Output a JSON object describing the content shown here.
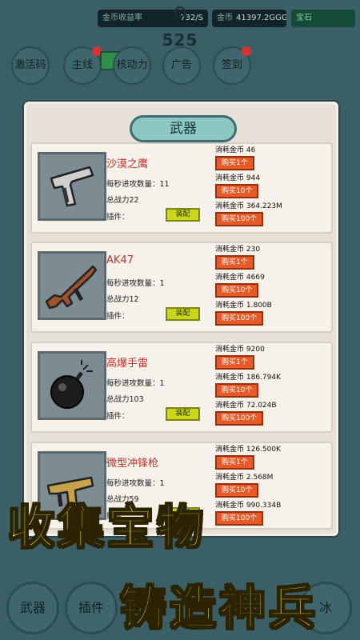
{
  "topbar": {
    "income_label": "金币收益率",
    "income_value": "732/S",
    "gold_label": "金币",
    "gold_value": "41397.2GGG",
    "green_label": "宝石",
    "center_number": "525"
  },
  "top_buttons": [
    {
      "label": "激活码",
      "badge": false
    },
    {
      "label": "主线",
      "badge": true
    },
    {
      "label": "核动力",
      "badge": false
    },
    {
      "label": "广告",
      "badge": false
    },
    {
      "label": "签到",
      "badge": true
    }
  ],
  "panel": {
    "title": "武器",
    "weapons": [
      {
        "name": "沙漠之鹰",
        "attacks_per_sec_label": "每秒进攻数量：",
        "attacks_per_sec": "11",
        "power_label": "总战力",
        "power": "22",
        "plugin_label": "插件：",
        "equip_label": "装配",
        "icon": "pistol-icon",
        "costs": [
          {
            "label": "消耗金币",
            "value": "46",
            "buy": "购买1个"
          },
          {
            "label": "消耗金币",
            "value": "944",
            "buy": "购买10个"
          },
          {
            "label": "消耗金币",
            "value": "364.223M",
            "buy": "购买100个"
          }
        ]
      },
      {
        "name": "AK47",
        "attacks_per_sec_label": "每秒进攻数量：",
        "attacks_per_sec": "1",
        "power_label": "总战力",
        "power": "12",
        "plugin_label": "插件：",
        "equip_label": "装配",
        "icon": "rifle-icon",
        "costs": [
          {
            "label": "消耗金币",
            "value": "230",
            "buy": "购买1个"
          },
          {
            "label": "消耗金币",
            "value": "4669",
            "buy": "购买10个"
          },
          {
            "label": "消耗金币",
            "value": "1.800B",
            "buy": "购买100个"
          }
        ]
      },
      {
        "name": "高爆手雷",
        "attacks_per_sec_label": "每秒进攻数量：",
        "attacks_per_sec": "1",
        "power_label": "总战力",
        "power": "103",
        "plugin_label": "插件：",
        "equip_label": "装配",
        "icon": "grenade-icon",
        "costs": [
          {
            "label": "消耗金币",
            "value": "9200",
            "buy": "购买1个"
          },
          {
            "label": "消耗金币",
            "value": "186.794K",
            "buy": "购买10个"
          },
          {
            "label": "消耗金币",
            "value": "72.024B",
            "buy": "购买100个"
          }
        ]
      },
      {
        "name": "微型冲锋枪",
        "attacks_per_sec_label": "每秒进攻数量：",
        "attacks_per_sec": "1",
        "power_label": "总战力",
        "power": "59",
        "plugin_label": "插件：",
        "equip_label": "装配",
        "icon": "smg-icon",
        "costs": [
          {
            "label": "消耗金币",
            "value": "126.500K",
            "buy": "购买1个"
          },
          {
            "label": "消耗金币",
            "value": "2.568M",
            "buy": "购买10个"
          },
          {
            "label": "消耗金币",
            "value": "990.334B",
            "buy": "购买100个"
          }
        ]
      }
    ]
  },
  "bottom_tabs": [
    {
      "label": "武器"
    },
    {
      "label": "插件"
    },
    {
      "label": "冰"
    }
  ],
  "promo": {
    "line1": "收集宝物",
    "line2": "铸造神兵"
  }
}
